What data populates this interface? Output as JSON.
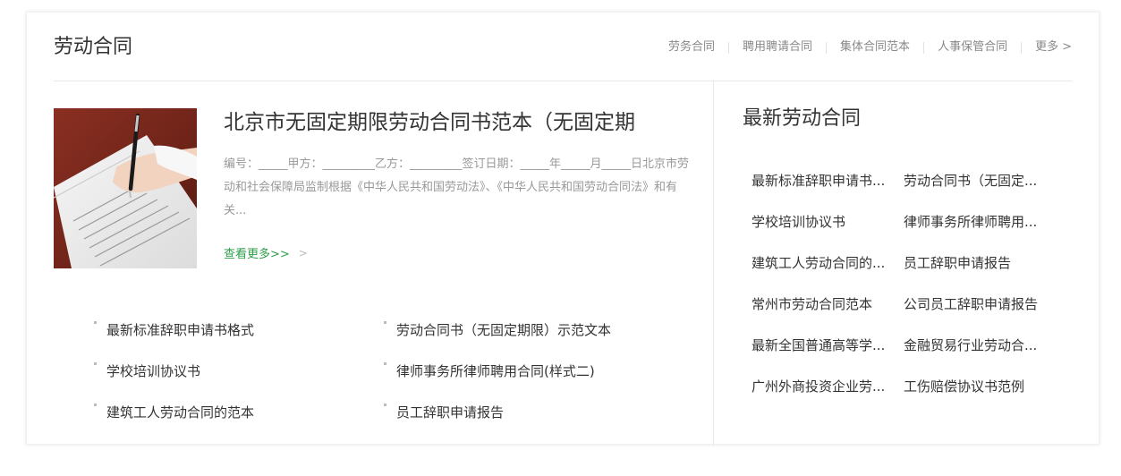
{
  "header": {
    "title": "劳动合同",
    "nav": [
      {
        "label": "劳务合同"
      },
      {
        "label": "聘用聘请合同"
      },
      {
        "label": "集体合同范本"
      },
      {
        "label": "人事保管合同"
      }
    ],
    "more_label": "更多",
    "more_arrow": ">"
  },
  "feature": {
    "image_alt": "signing contract photo",
    "title": "北京市无固定期限劳动合同书范本（无固定期",
    "description": "编号：_____甲方：_________乙方：_________签订日期：_____年_____月_____日北京市劳动和社会保障局监制根据《中华人民共和国劳动法》、《中华人民共和国劳动合同法》和有关...",
    "more_label": "查看更多>>",
    "more_chevron": ">"
  },
  "links": [
    {
      "label": "最新标准辞职申请书格式"
    },
    {
      "label": "劳动合同书（无固定期限）示范文本"
    },
    {
      "label": "学校培训协议书"
    },
    {
      "label": "律师事务所律师聘用合同(样式二)"
    },
    {
      "label": "建筑工人劳动合同的范本"
    },
    {
      "label": "员工辞职申请报告"
    }
  ],
  "sidebar": {
    "title": "最新劳动合同",
    "items": [
      {
        "label": "最新标准辞职申请书..."
      },
      {
        "label": "劳动合同书（无固定..."
      },
      {
        "label": "学校培训协议书"
      },
      {
        "label": "律师事务所律师聘用..."
      },
      {
        "label": "建筑工人劳动合同的..."
      },
      {
        "label": "员工辞职申请报告"
      },
      {
        "label": "常州市劳动合同范本"
      },
      {
        "label": "公司员工辞职申请报告"
      },
      {
        "label": "最新全国普通高等学..."
      },
      {
        "label": "金融贸易行业劳动合..."
      },
      {
        "label": "广州外商投资企业劳..."
      },
      {
        "label": "工伤赔偿协议书范例"
      }
    ]
  },
  "colors": {
    "accent_green": "#2e9e4a",
    "text_main": "#333333",
    "text_muted": "#999999",
    "divider": "#e8e8e8"
  }
}
